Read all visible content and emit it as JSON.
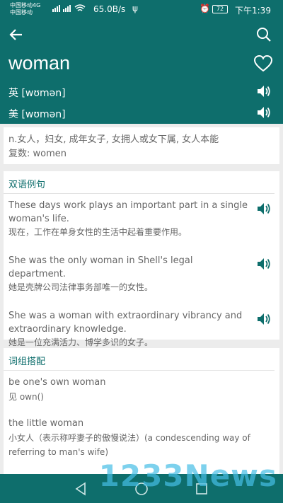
{
  "status_bar": {
    "carrier_line1": "中国移动4G",
    "carrier_line2": "中国移动",
    "network": "4G ",
    "speed": "65.0B/s",
    "battery": "72",
    "time": "下午1:39"
  },
  "header": {
    "word": "woman",
    "pron_uk": "英 [wʊmən]",
    "pron_us": "美 [wʊmən]"
  },
  "definition": {
    "line1": "n.女人，妇女, 成年女子, 女拥人或女下属, 女人本能",
    "line2": "复数: women"
  },
  "examples": {
    "title": "双语例句",
    "items": [
      {
        "en": "These days work plays an important part in a single woman's life.",
        "zh": "现在，工作在单身女性的生活中起着重要作用。"
      },
      {
        "en": "She was the only woman in Shell's legal department.",
        "zh": "她是壳牌公司法律事务部唯一的女性。"
      },
      {
        "en": "She was a woman with extraordinary vibrancy and extraordinary knowledge.",
        "zh": "她是一位充满活力、博学多识的女子。"
      }
    ]
  },
  "phrases": {
    "title": "词组搭配",
    "items": [
      {
        "en": "be one's own woman",
        "zh": "见 own()"
      },
      {
        "en": "the little woman",
        "zh": "小女人（表示称呼妻子的傲慢说法）(a condescending way of referring to man's wife)"
      }
    ]
  },
  "watermark": "1233News",
  "colors": {
    "primary": "#0e6e6c",
    "text": "#666666",
    "watermark": "#46bee6"
  }
}
